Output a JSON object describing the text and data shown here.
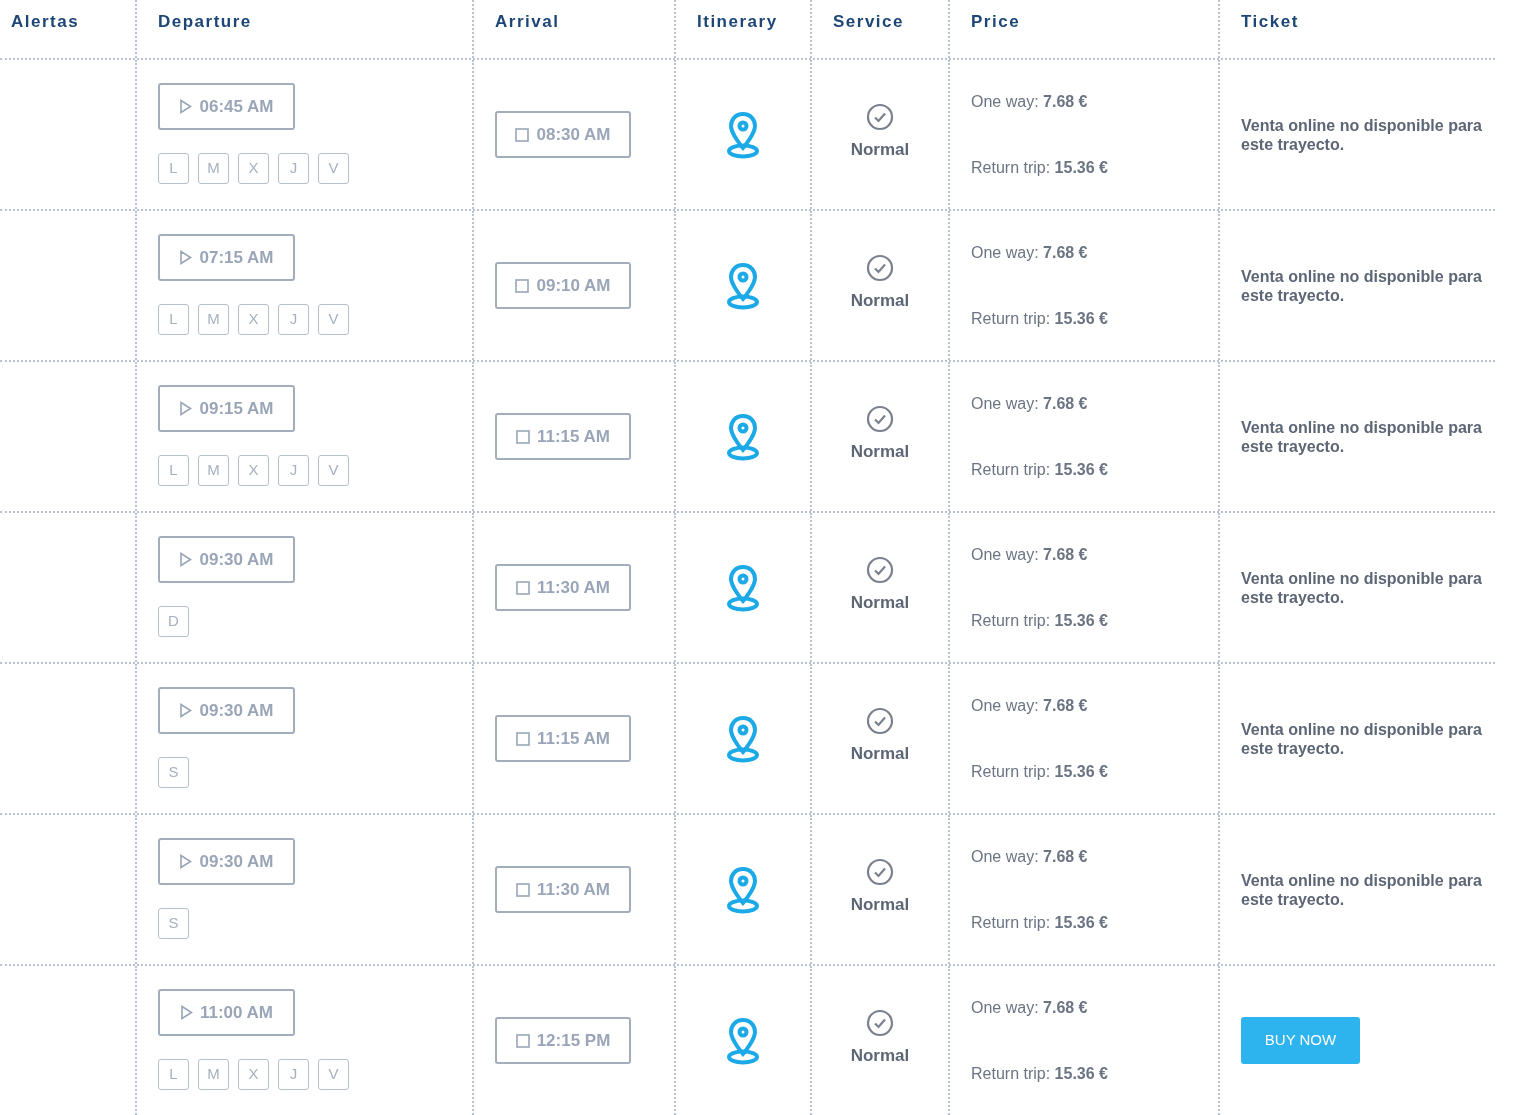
{
  "columns": [
    "Alertas",
    "Departure",
    "Arrival",
    "Itinerary",
    "Service",
    "Price",
    "Ticket"
  ],
  "rows": [
    {
      "departure": "06:45 AM",
      "days": [
        "L",
        "M",
        "X",
        "J",
        "V"
      ],
      "arrival": "08:30 AM",
      "service": "Normal",
      "one_way": "One way: **7.68 €**",
      "return_trip": "Return trip: **15.36 €**",
      "ticket": {
        "kind": "message",
        "text": "Venta online no disponible para este trayecto."
      }
    },
    {
      "departure": "07:15 AM",
      "days": [
        "L",
        "M",
        "X",
        "J",
        "V"
      ],
      "arrival": "09:10 AM",
      "service": "Normal",
      "one_way": "One way: **7.68 €**",
      "return_trip": "Return trip: **15.36 €**",
      "ticket": {
        "kind": "message",
        "text": "Venta online no disponible para este trayecto."
      }
    },
    {
      "departure": "09:15 AM",
      "days": [
        "L",
        "M",
        "X",
        "J",
        "V"
      ],
      "arrival": "11:15 AM",
      "service": "Normal",
      "one_way": "One way: **7.68 €**",
      "return_trip": "Return trip: **15.36 €**",
      "ticket": {
        "kind": "message",
        "text": "Venta online no disponible para este trayecto."
      }
    },
    {
      "departure": "09:30 AM",
      "days": [
        "D"
      ],
      "arrival": "11:30 AM",
      "service": "Normal",
      "one_way": "One way: **7.68 €**",
      "return_trip": "Return trip: **15.36 €**",
      "ticket": {
        "kind": "message",
        "text": "Venta online no disponible para este trayecto."
      }
    },
    {
      "departure": "09:30 AM",
      "days": [
        "S"
      ],
      "arrival": "11:15 AM",
      "service": "Normal",
      "one_way": "One way: **7.68 €**",
      "return_trip": "Return trip: **15.36 €**",
      "ticket": {
        "kind": "message",
        "text": "Venta online no disponible para este trayecto."
      }
    },
    {
      "departure": "09:30 AM",
      "days": [
        "S"
      ],
      "arrival": "11:30 AM",
      "service": "Normal",
      "one_way": "One way: **7.68 €**",
      "return_trip": "Return trip: **15.36 €**",
      "ticket": {
        "kind": "message",
        "text": "Venta online no disponible para este trayecto."
      }
    },
    {
      "departure": "11:00 AM",
      "days": [
        "L",
        "M",
        "X",
        "J",
        "V"
      ],
      "arrival": "12:15 PM",
      "service": "Normal",
      "one_way": "One way: **7.68 €**",
      "return_trip": "Return trip: **15.36 €**",
      "ticket": {
        "kind": "button",
        "text": "BUY NOW"
      }
    }
  ]
}
